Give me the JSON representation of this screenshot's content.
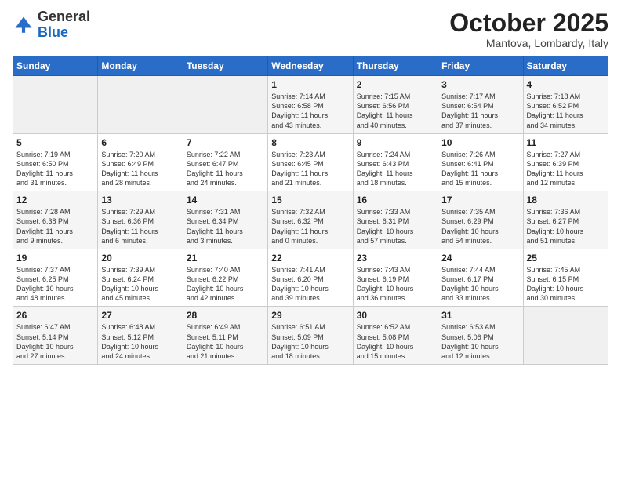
{
  "header": {
    "logo_general": "General",
    "logo_blue": "Blue",
    "title": "October 2025",
    "subtitle": "Mantova, Lombardy, Italy"
  },
  "days_of_week": [
    "Sunday",
    "Monday",
    "Tuesday",
    "Wednesday",
    "Thursday",
    "Friday",
    "Saturday"
  ],
  "weeks": [
    [
      {
        "day": "",
        "info": ""
      },
      {
        "day": "",
        "info": ""
      },
      {
        "day": "",
        "info": ""
      },
      {
        "day": "1",
        "info": "Sunrise: 7:14 AM\nSunset: 6:58 PM\nDaylight: 11 hours\nand 43 minutes."
      },
      {
        "day": "2",
        "info": "Sunrise: 7:15 AM\nSunset: 6:56 PM\nDaylight: 11 hours\nand 40 minutes."
      },
      {
        "day": "3",
        "info": "Sunrise: 7:17 AM\nSunset: 6:54 PM\nDaylight: 11 hours\nand 37 minutes."
      },
      {
        "day": "4",
        "info": "Sunrise: 7:18 AM\nSunset: 6:52 PM\nDaylight: 11 hours\nand 34 minutes."
      }
    ],
    [
      {
        "day": "5",
        "info": "Sunrise: 7:19 AM\nSunset: 6:50 PM\nDaylight: 11 hours\nand 31 minutes."
      },
      {
        "day": "6",
        "info": "Sunrise: 7:20 AM\nSunset: 6:49 PM\nDaylight: 11 hours\nand 28 minutes."
      },
      {
        "day": "7",
        "info": "Sunrise: 7:22 AM\nSunset: 6:47 PM\nDaylight: 11 hours\nand 24 minutes."
      },
      {
        "day": "8",
        "info": "Sunrise: 7:23 AM\nSunset: 6:45 PM\nDaylight: 11 hours\nand 21 minutes."
      },
      {
        "day": "9",
        "info": "Sunrise: 7:24 AM\nSunset: 6:43 PM\nDaylight: 11 hours\nand 18 minutes."
      },
      {
        "day": "10",
        "info": "Sunrise: 7:26 AM\nSunset: 6:41 PM\nDaylight: 11 hours\nand 15 minutes."
      },
      {
        "day": "11",
        "info": "Sunrise: 7:27 AM\nSunset: 6:39 PM\nDaylight: 11 hours\nand 12 minutes."
      }
    ],
    [
      {
        "day": "12",
        "info": "Sunrise: 7:28 AM\nSunset: 6:38 PM\nDaylight: 11 hours\nand 9 minutes."
      },
      {
        "day": "13",
        "info": "Sunrise: 7:29 AM\nSunset: 6:36 PM\nDaylight: 11 hours\nand 6 minutes."
      },
      {
        "day": "14",
        "info": "Sunrise: 7:31 AM\nSunset: 6:34 PM\nDaylight: 11 hours\nand 3 minutes."
      },
      {
        "day": "15",
        "info": "Sunrise: 7:32 AM\nSunset: 6:32 PM\nDaylight: 11 hours\nand 0 minutes."
      },
      {
        "day": "16",
        "info": "Sunrise: 7:33 AM\nSunset: 6:31 PM\nDaylight: 10 hours\nand 57 minutes."
      },
      {
        "day": "17",
        "info": "Sunrise: 7:35 AM\nSunset: 6:29 PM\nDaylight: 10 hours\nand 54 minutes."
      },
      {
        "day": "18",
        "info": "Sunrise: 7:36 AM\nSunset: 6:27 PM\nDaylight: 10 hours\nand 51 minutes."
      }
    ],
    [
      {
        "day": "19",
        "info": "Sunrise: 7:37 AM\nSunset: 6:25 PM\nDaylight: 10 hours\nand 48 minutes."
      },
      {
        "day": "20",
        "info": "Sunrise: 7:39 AM\nSunset: 6:24 PM\nDaylight: 10 hours\nand 45 minutes."
      },
      {
        "day": "21",
        "info": "Sunrise: 7:40 AM\nSunset: 6:22 PM\nDaylight: 10 hours\nand 42 minutes."
      },
      {
        "day": "22",
        "info": "Sunrise: 7:41 AM\nSunset: 6:20 PM\nDaylight: 10 hours\nand 39 minutes."
      },
      {
        "day": "23",
        "info": "Sunrise: 7:43 AM\nSunset: 6:19 PM\nDaylight: 10 hours\nand 36 minutes."
      },
      {
        "day": "24",
        "info": "Sunrise: 7:44 AM\nSunset: 6:17 PM\nDaylight: 10 hours\nand 33 minutes."
      },
      {
        "day": "25",
        "info": "Sunrise: 7:45 AM\nSunset: 6:15 PM\nDaylight: 10 hours\nand 30 minutes."
      }
    ],
    [
      {
        "day": "26",
        "info": "Sunrise: 6:47 AM\nSunset: 5:14 PM\nDaylight: 10 hours\nand 27 minutes."
      },
      {
        "day": "27",
        "info": "Sunrise: 6:48 AM\nSunset: 5:12 PM\nDaylight: 10 hours\nand 24 minutes."
      },
      {
        "day": "28",
        "info": "Sunrise: 6:49 AM\nSunset: 5:11 PM\nDaylight: 10 hours\nand 21 minutes."
      },
      {
        "day": "29",
        "info": "Sunrise: 6:51 AM\nSunset: 5:09 PM\nDaylight: 10 hours\nand 18 minutes."
      },
      {
        "day": "30",
        "info": "Sunrise: 6:52 AM\nSunset: 5:08 PM\nDaylight: 10 hours\nand 15 minutes."
      },
      {
        "day": "31",
        "info": "Sunrise: 6:53 AM\nSunset: 5:06 PM\nDaylight: 10 hours\nand 12 minutes."
      },
      {
        "day": "",
        "info": ""
      }
    ]
  ]
}
